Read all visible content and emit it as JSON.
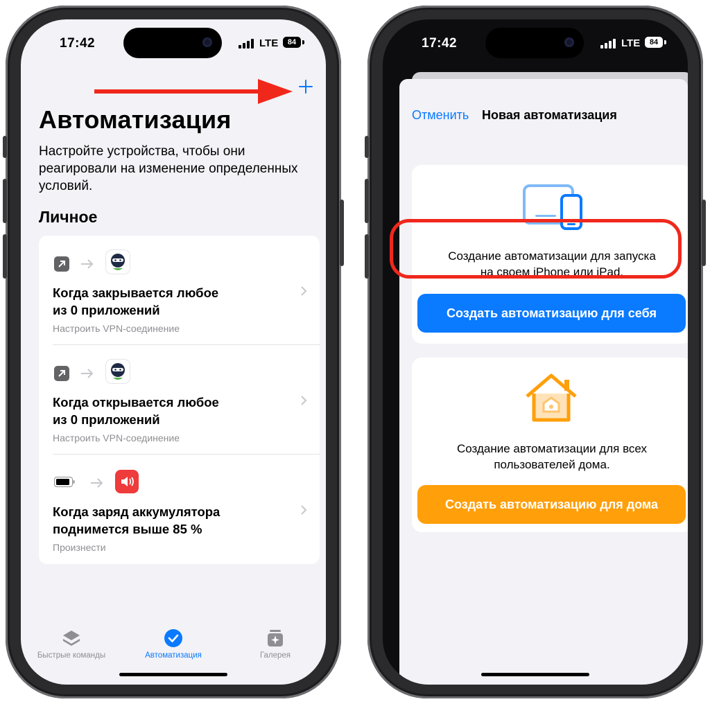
{
  "status_left": {
    "time": "17:42",
    "network": "LTE",
    "battery": "84"
  },
  "status_right": {
    "time": "17:42",
    "network": "LTE",
    "battery": "84"
  },
  "automation": {
    "title": "Автоматизация",
    "subtitle": "Настройте устройства, чтобы они реагировали на изменение определенных условий.",
    "section": "Личное",
    "items": [
      {
        "title_line1": "Когда закрывается любое",
        "title_line2": "из 0 приложений",
        "subtitle": "Настроить VPN-соединение",
        "trigger_icon": "app-open-arrow-icon",
        "action_icon": "vpn-ninja-icon"
      },
      {
        "title_line1": "Когда открывается любое",
        "title_line2": "из 0 приложений",
        "subtitle": "Настроить VPN-соединение",
        "trigger_icon": "app-open-arrow-icon",
        "action_icon": "vpn-ninja-icon"
      },
      {
        "title_line1": "Когда заряд аккумулятора",
        "title_line2": "поднимется выше 85 %",
        "subtitle": "Произнести",
        "trigger_icon": "battery-icon",
        "action_icon": "speaker-icon"
      }
    ]
  },
  "tabs": [
    {
      "label": "Быстрые команды",
      "icon": "layers-icon",
      "active": false
    },
    {
      "label": "Автоматизация",
      "icon": "clock-check-icon",
      "active": true
    },
    {
      "label": "Галерея",
      "icon": "gallery-icon",
      "active": false
    }
  ],
  "new_automation": {
    "cancel": "Отменить",
    "title": "Новая автоматизация",
    "personal_text_line1": "Создание автоматизации для запуска",
    "personal_text_line2": "на своем iPhone или iPad.",
    "personal_button": "Создать автоматизацию для себя",
    "home_text_line1": "Создание автоматизации для всех",
    "home_text_line2": "пользователей дома.",
    "home_button": "Создать автоматизацию для дома"
  },
  "colors": {
    "accent": "#0a7aff",
    "orange": "#ff9f0a",
    "annotation_red": "#f0281c"
  }
}
